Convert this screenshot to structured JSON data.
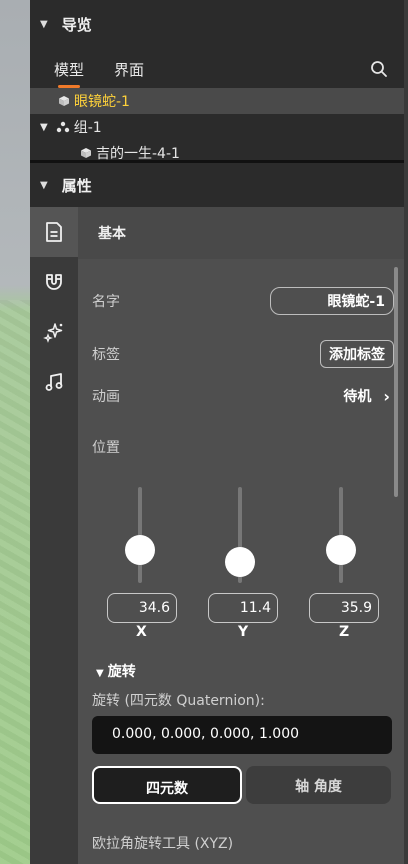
{
  "navigator": {
    "title": "导览",
    "tabs": [
      "模型",
      "界面"
    ],
    "tree": {
      "selected_item": "眼镜蛇-1",
      "group_item": "组-1",
      "child_item": "吉的一生-4-1"
    }
  },
  "properties": {
    "title": "属性",
    "tab_title": "基本",
    "name_label": "名字",
    "name_value": "眼镜蛇-1",
    "tags_label": "标签",
    "add_tag_label": "添加标签",
    "animation_label": "动画",
    "animation_value": "待机",
    "position_label": "位置",
    "position": {
      "x": "34.6",
      "y": "11.4",
      "z": "35.9",
      "x_label": "X",
      "y_label": "Y",
      "z_label": "Z"
    },
    "rotation": {
      "title": "旋转",
      "quat_label": "旋转 (四元数 Quaternion):",
      "quat_value": "0.000, 0.000, 0.000, 1.000",
      "mode_quat": "四元数",
      "mode_axis": "轴 角度",
      "euler_label": "欧拉角旋转工具 (XYZ)"
    }
  },
  "colors": {
    "accent": "#f07a2a",
    "selected_text": "#ffd23a"
  }
}
